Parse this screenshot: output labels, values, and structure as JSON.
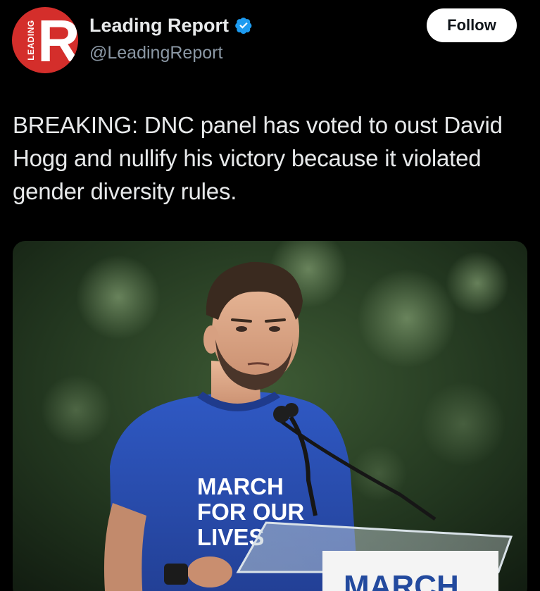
{
  "author": {
    "avatar_logo_letter": "R",
    "avatar_logo_text": "LEADING",
    "display_name": "Leading Report",
    "handle": "@LeadingReport",
    "verified_icon": "verified-badge-icon"
  },
  "actions": {
    "follow_label": "Follow"
  },
  "tweet": {
    "text": "BREAKING: DNC panel has voted to oust David Hogg and nullify his victory because it violated gender diversity rules."
  },
  "media": {
    "shirt_line1": "MARCH",
    "shirt_line2": "FOR OUR",
    "shirt_line3": "LIVES",
    "podium_sign": "MARCH"
  },
  "colors": {
    "background": "#000000",
    "text": "#e7e9ea",
    "secondary_text": "#8b98a5",
    "verified_blue": "#1d9bf0",
    "brand_red": "#d42e2b",
    "follow_bg": "#ffffff"
  }
}
